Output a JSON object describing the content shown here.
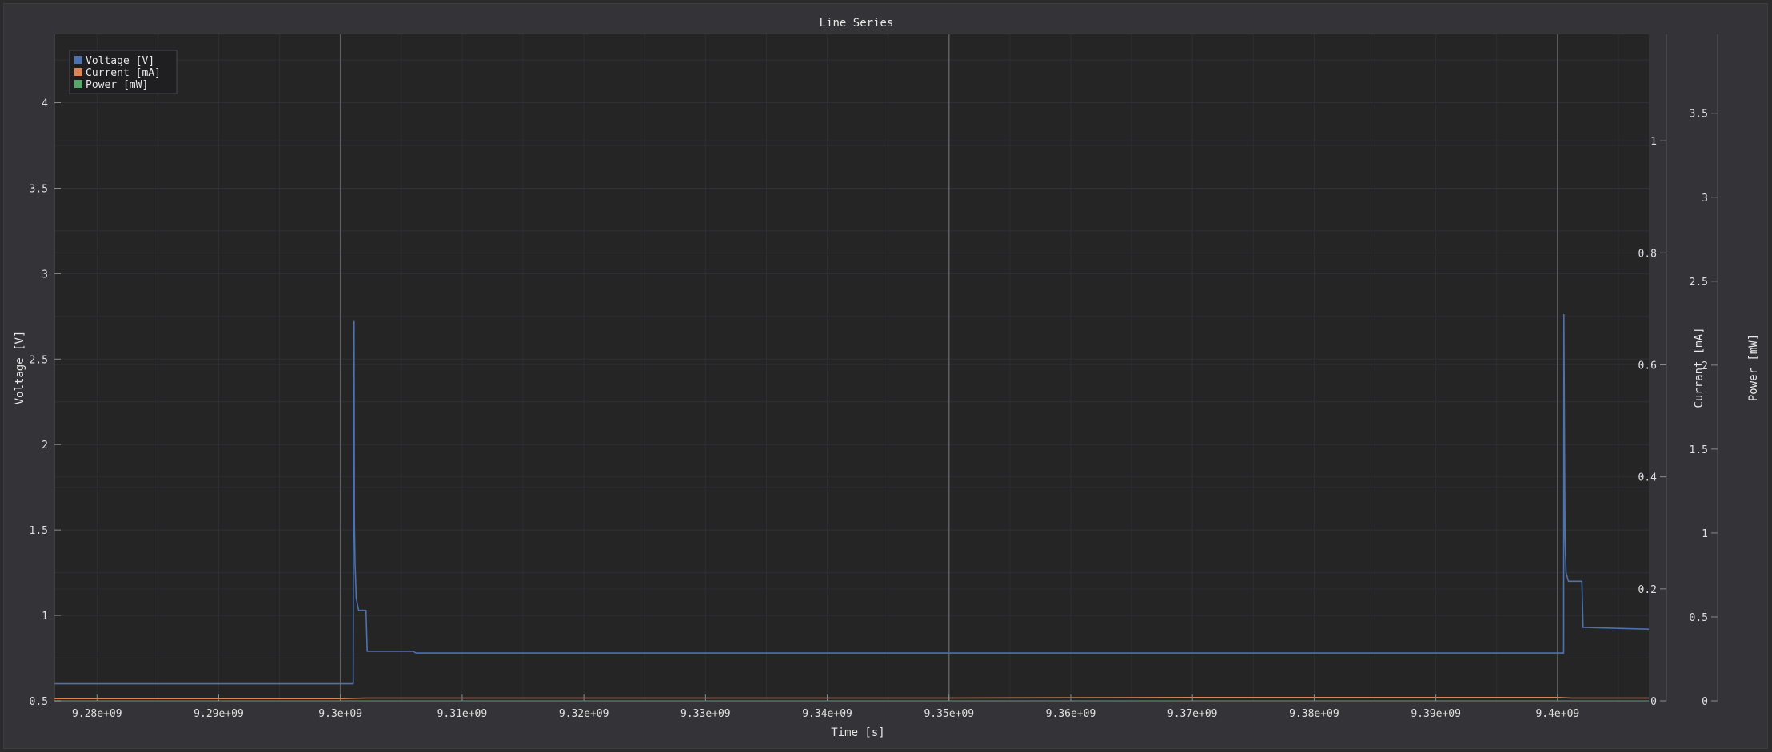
{
  "chart_data": {
    "type": "line",
    "title": "Line Series",
    "xlabel": "Time [s]",
    "y_axes": {
      "left": {
        "label": "Voltage [V]",
        "range": [
          0.5,
          4.4
        ],
        "ticks": [
          0.5,
          1,
          1.5,
          2,
          2.5,
          3,
          3.5,
          4
        ],
        "tick_labels": [
          "0.5",
          "1",
          "1.5",
          "2",
          "2.5",
          "3",
          "3.5",
          "4"
        ]
      },
      "right1": {
        "label": "Currant [mA]",
        "range": [
          0,
          1.19
        ],
        "ticks": [
          0,
          0.2,
          0.4,
          0.6,
          0.8,
          1
        ],
        "tick_labels": [
          "0",
          "0.2",
          "0.4",
          "0.6",
          "0.8",
          "1"
        ]
      },
      "right2": {
        "label": "Power [mW]",
        "range": [
          0,
          3.97
        ],
        "ticks": [
          0,
          0.5,
          1,
          1.5,
          2,
          2.5,
          3,
          3.5
        ],
        "tick_labels": [
          "0",
          "0.5",
          "1",
          "1.5",
          "2",
          "2.5",
          "3",
          "3.5"
        ]
      }
    },
    "x_axis": {
      "range": [
        9276500000.0,
        9407500000.0
      ],
      "ticks": [
        9280000000.0,
        9290000000.0,
        9300000000.0,
        9310000000.0,
        9320000000.0,
        9330000000.0,
        9340000000.0,
        9350000000.0,
        9360000000.0,
        9370000000.0,
        9380000000.0,
        9390000000.0,
        9400000000.0
      ],
      "tick_labels": [
        "9.28e+09",
        "9.29e+09",
        "9.3e+09",
        "9.31e+09",
        "9.32e+09",
        "9.33e+09",
        "9.34e+09",
        "9.35e+09",
        "9.36e+09",
        "9.37e+09",
        "9.38e+09",
        "9.39e+09",
        "9.4e+09"
      ]
    },
    "markers": [
      9300000000.0,
      9350000000.0,
      9400000000.0
    ],
    "grid": true,
    "legend_position": "top-left",
    "series": [
      {
        "name": "Voltage [V]",
        "axis": "left",
        "color": "#4c72b0",
        "x": [
          9276500000.0,
          9301050000.0,
          9301080000.0,
          9301120000.0,
          9301150000.0,
          9301200000.0,
          9301300000.0,
          9301500000.0,
          9302000000.0,
          9302100000.0,
          9302200000.0,
          9306000000.0,
          9306200000.0,
          9400500000.0,
          9400520000.0,
          9400580000.0,
          9400620000.0,
          9400700000.0,
          9400900000.0,
          9401300000.0,
          9401400000.0,
          9402000000.0,
          9402100000.0,
          9407500000.0
        ],
        "y": [
          0.6,
          0.6,
          2.22,
          2.72,
          1.55,
          1.3,
          1.1,
          1.03,
          1.03,
          1.03,
          0.79,
          0.79,
          0.78,
          0.78,
          2.76,
          1.92,
          1.45,
          1.25,
          1.2,
          1.2,
          1.2,
          1.2,
          0.93,
          0.92
        ]
      },
      {
        "name": "Current [mA]",
        "axis": "right1",
        "color": "#dd8452",
        "x": [
          9276500000.0,
          9300000000.0,
          9302100000.0,
          9320000000.0,
          9350000000.0,
          9370000000.0,
          9400000000.0,
          9401200000.0,
          9407500000.0
        ],
        "y": [
          0.004,
          0.004,
          0.005,
          0.005,
          0.005,
          0.006,
          0.006,
          0.005,
          0.005
        ]
      },
      {
        "name": "Power [mW]",
        "axis": "right2",
        "color": "#55a868",
        "x": [
          9276500000.0,
          9407500000.0
        ],
        "y": [
          0.0,
          0.0
        ]
      }
    ]
  }
}
